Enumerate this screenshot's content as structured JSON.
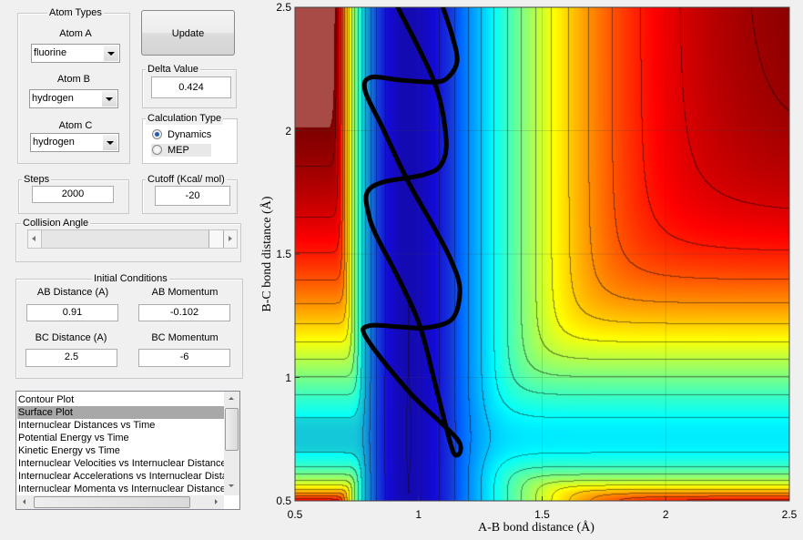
{
  "atom_types": {
    "title": "Atom Types",
    "atom_a": {
      "label": "Atom A",
      "value": "fluorine"
    },
    "atom_b": {
      "label": "Atom B",
      "value": "hydrogen"
    },
    "atom_c": {
      "label": "Atom C",
      "value": "hydrogen"
    }
  },
  "update_label": "Update",
  "delta": {
    "title": "Delta Value",
    "value": "0.424"
  },
  "calc_type": {
    "title": "Calculation Type",
    "options": [
      "Dynamics",
      "MEP"
    ],
    "selected": "Dynamics"
  },
  "steps": {
    "title": "Steps",
    "value": "2000"
  },
  "cutoff": {
    "title": "Cutoff (Kcal/ mol)",
    "value": "-20"
  },
  "collision_angle": {
    "title": "Collision Angle",
    "slider_fraction": 1.0
  },
  "initial_conditions": {
    "title": "Initial Conditions",
    "ab_distance": {
      "label": "AB Distance (A)",
      "value": "0.91"
    },
    "ab_momentum": {
      "label": "AB Momentum",
      "value": "-0.102"
    },
    "bc_distance": {
      "label": "BC Distance (A)",
      "value": "2.5"
    },
    "bc_momentum": {
      "label": "BC Momentum",
      "value": "-6"
    }
  },
  "plot_list": {
    "items": [
      "Contour Plot",
      "Surface Plot",
      "Internuclear Distances vs Time",
      "Potential Energy vs Time",
      "Kinetic Energy vs Time",
      "Internuclear Velocities vs Internuclear Distance",
      "Internuclear Accelerations vs Internuclear Dista",
      "Internuclear Momenta vs Internuclear Distance"
    ],
    "selected": "Surface Plot"
  },
  "chart_data": {
    "type": "contour",
    "xlabel": "A-B bond distance (Å)",
    "ylabel": "B-C bond distance (Å)",
    "xlim": [
      0.5,
      2.5
    ],
    "ylim": [
      0.5,
      2.5
    ],
    "xticks": [
      "0.5",
      "1",
      "1.5",
      "2",
      "2.5"
    ],
    "yticks": [
      "0.5",
      "1",
      "1.5",
      "2",
      "2.5"
    ],
    "grid": true,
    "colormap": "jet",
    "clip_color": "#a84a46",
    "trajectory_color": "#000000",
    "trajectory": [
      [
        0.916,
        2.5
      ],
      [
        1.064,
        2.197
      ],
      [
        1.111,
        1.976
      ],
      [
        1.093,
        1.865
      ],
      [
        1.019,
        1.821
      ],
      [
        0.854,
        1.791
      ],
      [
        0.791,
        1.747
      ],
      [
        0.798,
        1.662
      ],
      [
        0.828,
        1.577
      ],
      [
        0.927,
        1.386
      ],
      [
        1.008,
        1.201
      ],
      [
        1.075,
        0.943
      ],
      [
        1.141,
        0.696
      ],
      [
        1.159,
        0.747
      ],
      [
        0.964,
        0.939
      ],
      [
        0.791,
        1.157
      ],
      [
        0.798,
        1.209
      ],
      [
        0.927,
        1.205
      ],
      [
        1.027,
        1.201
      ],
      [
        1.137,
        1.238
      ],
      [
        1.167,
        1.36
      ],
      [
        1.13,
        1.478
      ],
      [
        1.067,
        1.6
      ],
      [
        0.953,
        1.803
      ],
      [
        0.854,
        2.013
      ],
      [
        0.784,
        2.161
      ],
      [
        0.806,
        2.216
      ],
      [
        0.927,
        2.205
      ],
      [
        1.064,
        2.197
      ],
      [
        1.119,
        2.216
      ],
      [
        1.156,
        2.282
      ],
      [
        1.137,
        2.382
      ],
      [
        1.1,
        2.496
      ]
    ]
  }
}
